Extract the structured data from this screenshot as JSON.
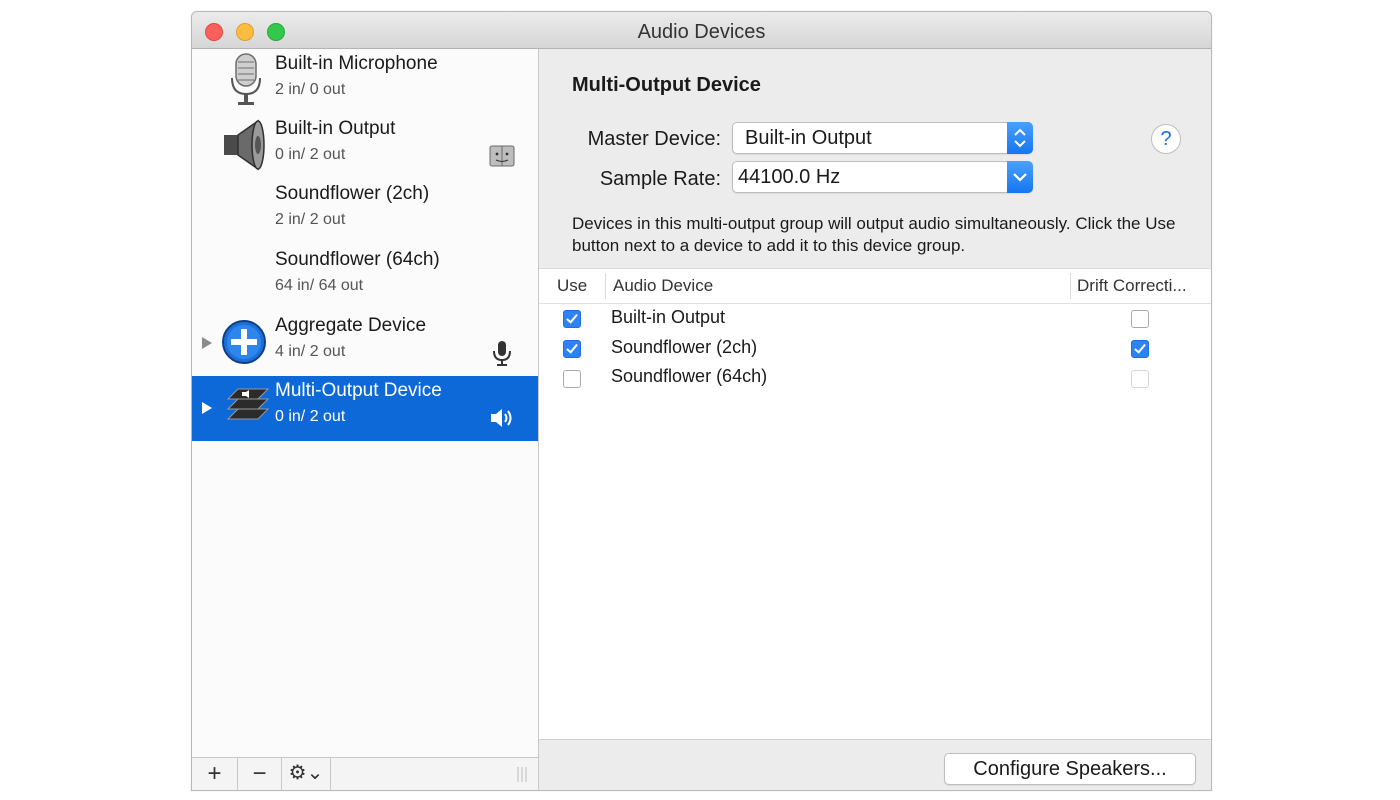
{
  "window": {
    "title": "Audio Devices"
  },
  "sidebar": {
    "devices": [
      {
        "name": "Built-in Microphone",
        "io": "2 in/ 0 out",
        "icon": "microphone-icon",
        "selected": false
      },
      {
        "name": "Built-in Output",
        "io": "0 in/ 2 out",
        "icon": "speaker-icon",
        "badge": "finder-icon",
        "selected": false
      },
      {
        "name": "Soundflower (2ch)",
        "io": "2 in/ 2 out",
        "selected": false
      },
      {
        "name": "Soundflower (64ch)",
        "io": "64 in/ 64 out",
        "selected": false
      },
      {
        "name": "Aggregate Device",
        "io": "4 in/ 2 out",
        "icon": "aggregate-plus-icon",
        "badge": "microphone-badge-icon",
        "selected": false
      },
      {
        "name": "Multi-Output Device",
        "io": "0 in/ 2 out",
        "icon": "multi-output-stack-icon",
        "badge": "speaker-volume-icon",
        "selected": true
      }
    ],
    "toolbar": {
      "add": "+",
      "remove": "−",
      "gear": "⚙⌄"
    }
  },
  "main": {
    "title": "Multi-Output Device",
    "master_label": "Master Device:",
    "master_value": "Built-in Output",
    "rate_label": "Sample Rate:",
    "rate_value": "44100.0 Hz",
    "help": "?",
    "description": "Devices in this multi-output group will output audio simultaneously. Click the Use button next to a device to add it to this device group.",
    "table": {
      "headers": {
        "use": "Use",
        "device": "Audio Device",
        "drift": "Drift Correcti..."
      },
      "rows": [
        {
          "name": "Built-in Output",
          "use": true,
          "drift": false
        },
        {
          "name": "Soundflower (2ch)",
          "use": true,
          "drift": true
        },
        {
          "name": "Soundflower (64ch)",
          "use": false,
          "drift": false
        }
      ]
    },
    "configure_button": "Configure Speakers..."
  },
  "colors": {
    "selection": "#0d68d8",
    "accent": "#2e82f6"
  }
}
